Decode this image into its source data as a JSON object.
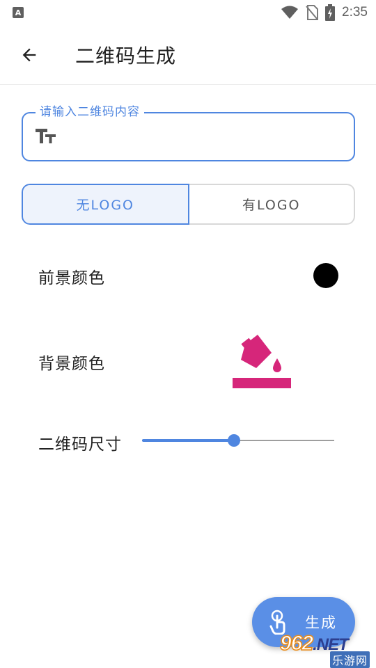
{
  "status_bar": {
    "app_icon_letter": "A",
    "icons": [
      "wifi-icon",
      "no-sim-icon",
      "battery-charging-icon"
    ],
    "time": "2:35"
  },
  "app_bar": {
    "back_icon": "arrow-back-icon",
    "title": "二维码生成"
  },
  "content_input": {
    "label": "请输入二维码内容",
    "icon": "text-fields-icon",
    "value": ""
  },
  "logo_toggle": {
    "options": [
      {
        "label": "无LOGO",
        "selected": true
      },
      {
        "label": "有LOGO",
        "selected": false
      }
    ]
  },
  "foreground": {
    "label": "前景颜色",
    "color": "#000000"
  },
  "background": {
    "label": "背景颜色",
    "icon": "paint-bucket-icon",
    "color": "#d6267a"
  },
  "size": {
    "label": "二维码尺寸",
    "value_fraction": 0.48
  },
  "fab": {
    "icon": "touch-icon",
    "label": "生成"
  },
  "watermark": {
    "top_number": "962",
    "top_suffix": ".NET",
    "bottom": "乐游网"
  },
  "colors": {
    "accent": "#4f86e0",
    "fab": "#5a8fe6",
    "toggle_selected_bg": "#eef3fc"
  }
}
